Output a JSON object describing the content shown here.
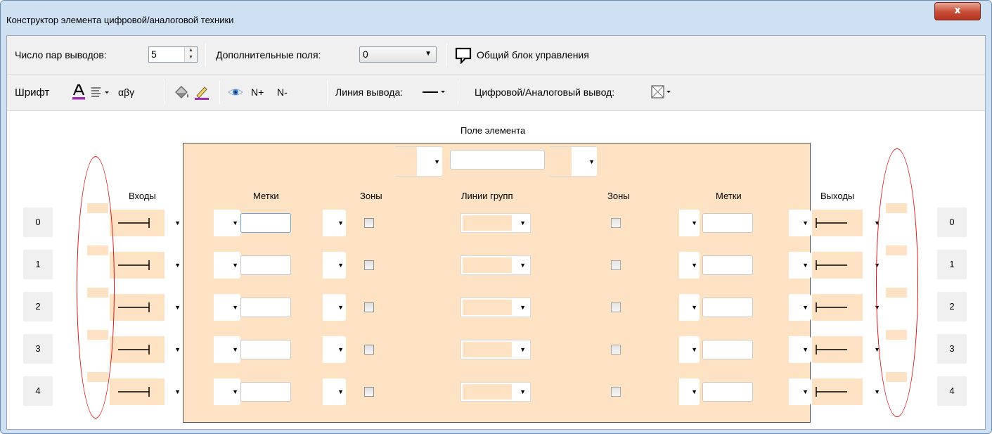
{
  "window": {
    "title": "Конструктор элемента цифровой/аналоговой техники",
    "close_label": "x"
  },
  "toolbar1": {
    "pins_label": "Число пар выводов:",
    "pins_value": "5",
    "extra_fields_label": "Дополнительные поля:",
    "extra_fields_value": "0",
    "control_block_label": "Общий блок управления"
  },
  "toolbar2": {
    "font_label": "Шрифт",
    "greek_label": "αβγ",
    "n_plus_label": "N+",
    "n_minus_label": "N-",
    "line_label": "Линия вывода:",
    "digital_analog_label": "Цифровой/Аналоговый вывод:"
  },
  "designer": {
    "element_field_label": "Поле элемента",
    "headers": {
      "inputs": "Входы",
      "labels_left": "Метки",
      "zones_left": "Зоны",
      "group_lines": "Линии групп",
      "zones_right": "Зоны",
      "labels_right": "Метки",
      "outputs": "Выходы"
    },
    "rows": [
      {
        "left_index": "0",
        "right_index": "0"
      },
      {
        "left_index": "1",
        "right_index": "1"
      },
      {
        "left_index": "2",
        "right_index": "2"
      },
      {
        "left_index": "3",
        "right_index": "3"
      },
      {
        "left_index": "4",
        "right_index": "4"
      }
    ]
  },
  "colors": {
    "element_fill": "#fde2c3",
    "annotation": "#dd1111",
    "font_color_underline": "#9b2fae"
  },
  "icons": {
    "spinner": "spin-arrows-icon",
    "dropdown": "chevron-down-icon",
    "control_block": "control-block-icon",
    "font_color": "font-color-icon",
    "alignment": "text-align-icon",
    "fill": "paint-bucket-icon",
    "pen": "pen-icon",
    "visibility": "eye-icon",
    "pin_in": "pin-input-icon",
    "pin_out": "pin-output-icon",
    "digital_analog": "crossed-box-icon"
  }
}
